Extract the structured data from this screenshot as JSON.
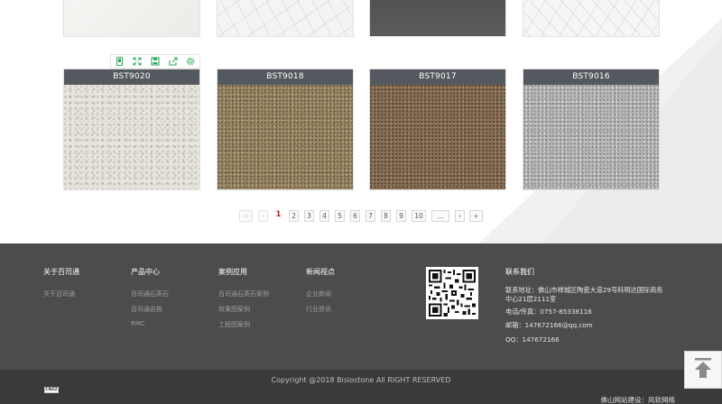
{
  "products": [
    {
      "code": "BST9020"
    },
    {
      "code": "BST9018"
    },
    {
      "code": "BST9017"
    },
    {
      "code": "BST9016"
    }
  ],
  "tile_toolbar": {
    "icons": [
      "mobile-icon",
      "fullscreen-icon",
      "save-icon",
      "share-icon",
      "settings-icon"
    ]
  },
  "pagination": {
    "first": "«",
    "prev": "‹",
    "pages": [
      "1",
      "2",
      "3",
      "4",
      "5",
      "6",
      "7",
      "8",
      "9",
      "10"
    ],
    "current": "1",
    "ellipsis": "...",
    "next": "›",
    "last": "»"
  },
  "footer": {
    "columns": [
      {
        "title": "关于百司通",
        "links": [
          "关于百司通"
        ]
      },
      {
        "title": "产品中心",
        "links": [
          "百司通石英石",
          "百司通岩板",
          "RMC"
        ]
      },
      {
        "title": "案例应用",
        "links": [
          "百司通石英石案例",
          "效果图案例",
          "工程图案例"
        ]
      },
      {
        "title": "新闻视点",
        "links": [
          "企业新闻",
          "行业资讯"
        ]
      }
    ],
    "contact": {
      "title": "联系我们",
      "address_line1": "联系地址：佛山市禅城区陶瓷大道29号科明达国际商务",
      "address_line2": "中心21层2111室",
      "phone": "电话/传真：0757-85338116",
      "email": "邮箱：147672166@qq.com",
      "qq": "QQ：147672166"
    }
  },
  "bottom": {
    "copyright": "Copyright @2018 Bisiostone All RIGHT RESERVED",
    "support": "佛山网站建设：风软网络",
    "cnzz": "CNZZ"
  },
  "colors": {
    "tile_label_bg": "#54595f",
    "footer_bg": "#4c4c4c",
    "bottom_bg": "#3a3a3a",
    "current_page": "#d21a1a",
    "toolbar_icon": "#2faa5b"
  }
}
